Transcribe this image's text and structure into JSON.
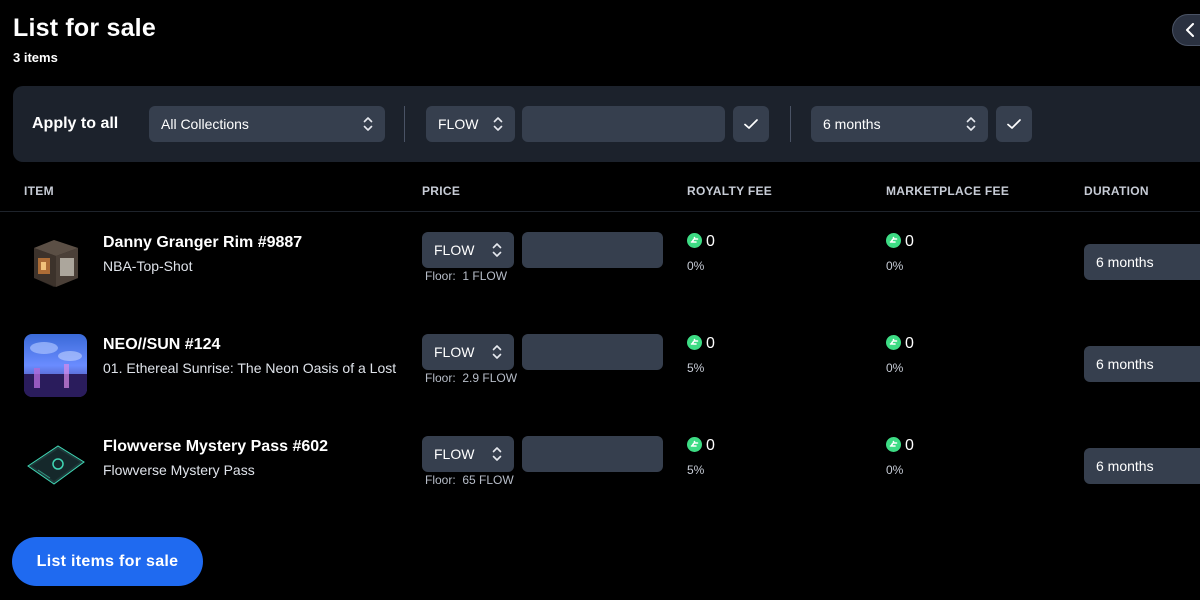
{
  "header": {
    "title": "List for sale",
    "item_count": "3 items"
  },
  "apply_bar": {
    "label": "Apply to all",
    "collection_select": "All Collections",
    "currency_select": "FLOW",
    "price_value": "",
    "duration_select": "6 months"
  },
  "table": {
    "columns": [
      "ITEM",
      "PRICE",
      "ROYALTY FEE",
      "MARKETPLACE FEE",
      "DURATION"
    ],
    "rows": [
      {
        "name": "Danny Granger Rim #9887",
        "collection": "NBA-Top-Shot",
        "currency": "FLOW",
        "price": "",
        "floor_label": "Floor:",
        "floor_value": "1 FLOW",
        "royalty_value": "0",
        "royalty_pct": "0%",
        "marketplace_value": "0",
        "marketplace_pct": "0%",
        "duration": "6 months"
      },
      {
        "name": "NEO//SUN #124",
        "collection": "01. Ethereal Sunrise: The Neon Oasis of a Lost",
        "currency": "FLOW",
        "price": "",
        "floor_label": "Floor:",
        "floor_value": "2.9 FLOW",
        "royalty_value": "0",
        "royalty_pct": "5%",
        "marketplace_value": "0",
        "marketplace_pct": "0%",
        "duration": "6 months"
      },
      {
        "name": "Flowverse Mystery Pass #602",
        "collection": "Flowverse Mystery Pass",
        "currency": "FLOW",
        "price": "",
        "floor_label": "Floor:",
        "floor_value": "65 FLOW",
        "royalty_value": "0",
        "royalty_pct": "5%",
        "marketplace_value": "0",
        "marketplace_pct": "0%",
        "duration": "6 months"
      }
    ]
  },
  "footer": {
    "list_button": "List items for sale"
  },
  "colors": {
    "background": "#000000",
    "panel": "#1c222c",
    "control": "#363f4e",
    "accent": "#1f6af0",
    "flow_green": "#3ddc84"
  },
  "icons": {
    "back": "chevron-left-icon",
    "select": "chevron-up-down-icon",
    "confirm": "check-icon",
    "token": "flow-token-icon"
  }
}
